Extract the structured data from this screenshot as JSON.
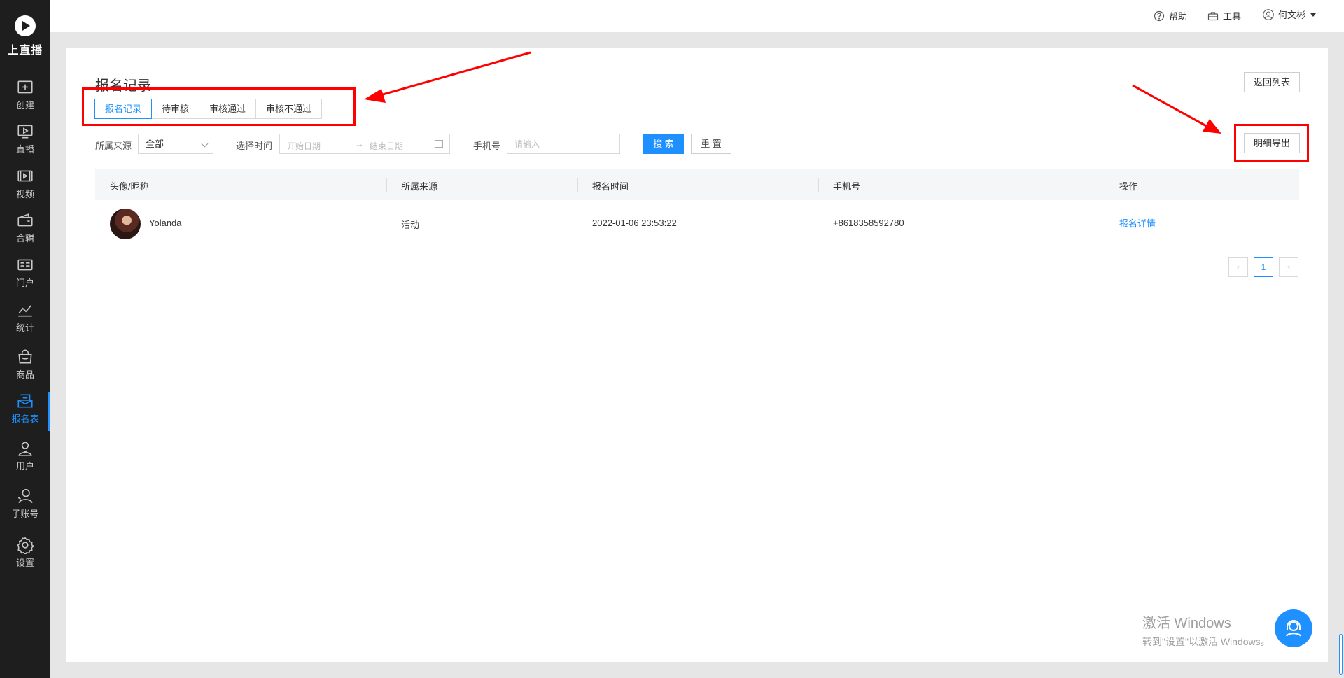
{
  "app": {
    "logo_text": "上直播"
  },
  "sidebar": {
    "items": [
      {
        "label": "创建",
        "icon": "plus-square-icon"
      },
      {
        "label": "直播",
        "icon": "live-screen-icon"
      },
      {
        "label": "视频",
        "icon": "video-icon"
      },
      {
        "label": "合辑",
        "icon": "wallet-icon"
      },
      {
        "label": "门户",
        "icon": "portal-icon"
      },
      {
        "label": "统计",
        "icon": "chart-icon"
      },
      {
        "label": "商品",
        "icon": "bag-icon"
      },
      {
        "label": "报名表",
        "icon": "registration-icon",
        "active": true
      },
      {
        "label": "用户",
        "icon": "user-icon"
      },
      {
        "label": "子账号",
        "icon": "sub-account-icon"
      },
      {
        "label": "设置",
        "icon": "gear-icon"
      }
    ]
  },
  "topbar": {
    "help": "帮助",
    "tools": "工具",
    "username": "何文彬"
  },
  "page": {
    "title": "报名记录",
    "back_button": "返回列表",
    "export_button": "明细导出"
  },
  "tabs": [
    {
      "label": "报名记录",
      "active": true
    },
    {
      "label": "待审核"
    },
    {
      "label": "审核通过"
    },
    {
      "label": "审核不通过"
    }
  ],
  "filters": {
    "source_label": "所属来源",
    "source_value": "全部",
    "time_label": "选择时间",
    "start_placeholder": "开始日期",
    "end_placeholder": "结束日期",
    "phone_label": "手机号",
    "phone_placeholder": "请输入",
    "search_button": "搜 索",
    "reset_button": "重 置"
  },
  "table": {
    "columns": [
      "头像/昵称",
      "所属来源",
      "报名时间",
      "手机号",
      "操作"
    ],
    "rows": [
      {
        "nickname": "Yolanda",
        "source": "活动",
        "time": "2022-01-06 23:53:22",
        "phone": "+8618358592780",
        "action": "报名详情"
      }
    ]
  },
  "pagination": {
    "current": "1"
  },
  "watermark": {
    "title": "激活 Windows",
    "subtitle": "转到\"设置\"以激活 Windows。"
  },
  "colors": {
    "accent": "#1e90ff",
    "annotation": "#ff0000",
    "sidebar_bg": "#1e1e1e"
  }
}
